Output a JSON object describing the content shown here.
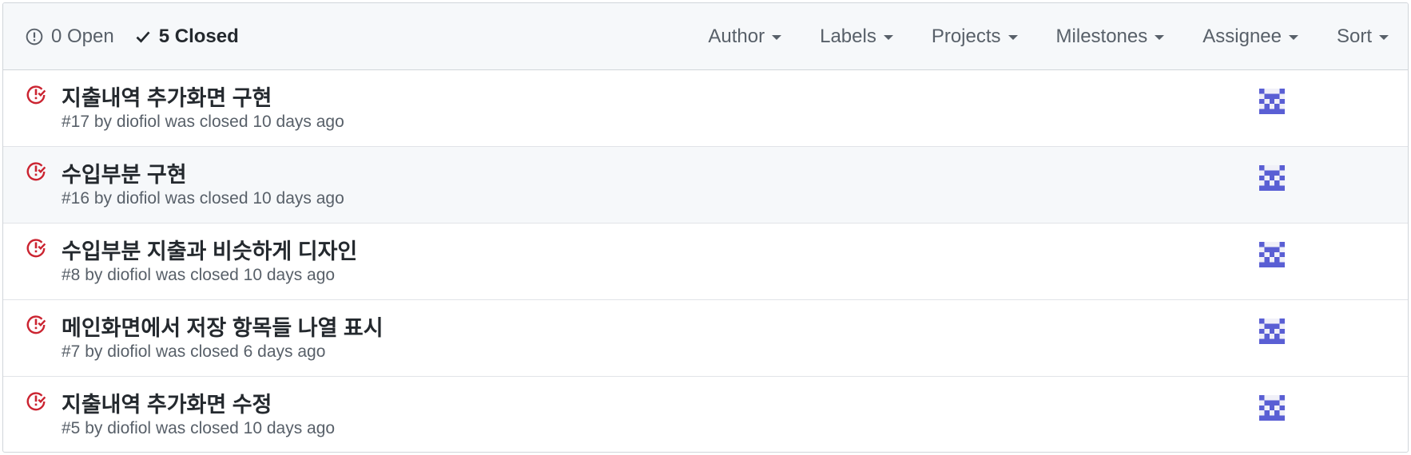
{
  "states": {
    "open_count_label": "0 Open",
    "closed_count_label": "5 Closed"
  },
  "filters": [
    "Author",
    "Labels",
    "Projects",
    "Milestones",
    "Assignee",
    "Sort"
  ],
  "issues": [
    {
      "title": "지출내역 추가화면 구현",
      "number": "#17",
      "author": "diofiol",
      "status": "was closed 10 days ago"
    },
    {
      "title": "수입부분 구현",
      "number": "#16",
      "author": "diofiol",
      "status": "was closed 10 days ago"
    },
    {
      "title": "수입부분 지출과 비슷하게 디자인",
      "number": "#8",
      "author": "diofiol",
      "status": "was closed 10 days ago"
    },
    {
      "title": "메인화면에서 저장 항목들 나열 표시",
      "number": "#7",
      "author": "diofiol",
      "status": "was closed 6 days ago"
    },
    {
      "title": "지출내역 추가화면 수정",
      "number": "#5",
      "author": "diofiol",
      "status": "was closed 10 days ago"
    }
  ],
  "colors": {
    "closed_icon": "#cb2431",
    "avatar": "#5a5fd4",
    "header_bg": "#f6f8fa",
    "border": "#d1d5da"
  },
  "icons": {
    "open": "issue-opened-icon",
    "closed": "check-icon",
    "issue_closed": "issue-closed-icon",
    "avatar": "identicon-avatar"
  }
}
